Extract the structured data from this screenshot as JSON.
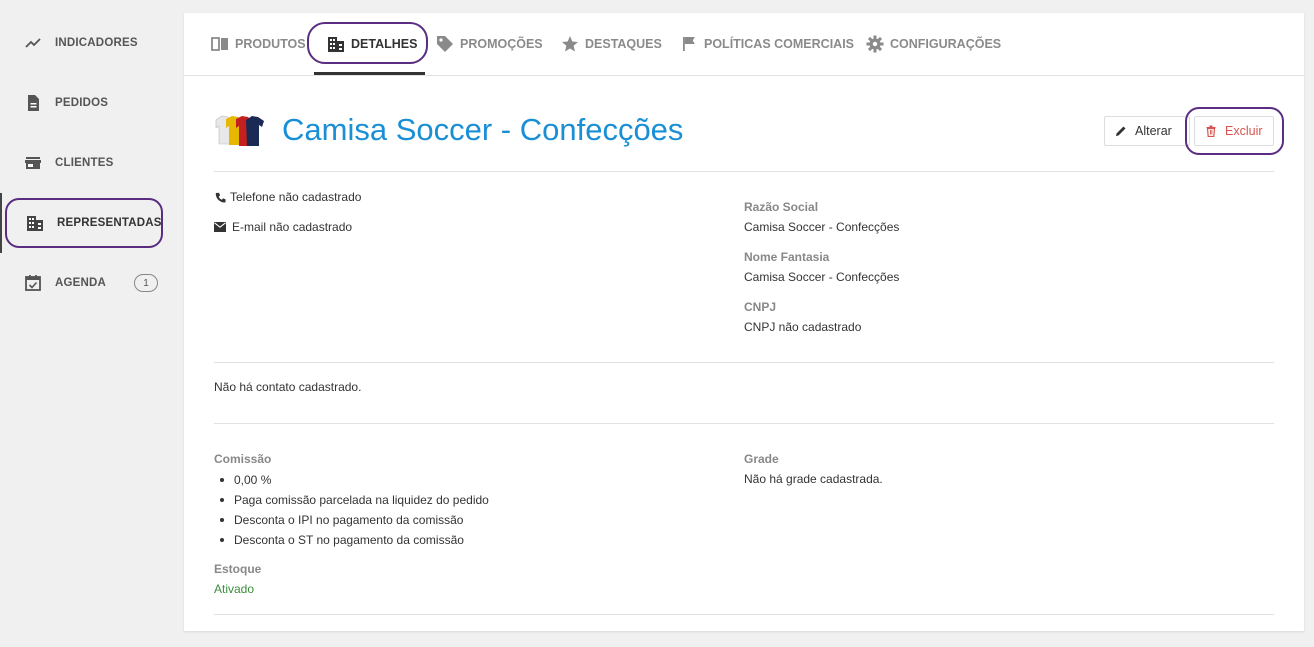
{
  "sidebar": {
    "items": [
      {
        "label": "INDICADORES",
        "icon": "trending-up-icon"
      },
      {
        "label": "PEDIDOS",
        "icon": "document-icon"
      },
      {
        "label": "CLIENTES",
        "icon": "store-icon"
      },
      {
        "label": "REPRESENTADAS",
        "icon": "building-icon",
        "active": true
      },
      {
        "label": "AGENDA",
        "icon": "calendar-check-icon",
        "badge": "1"
      }
    ]
  },
  "tabs": [
    {
      "label": "PRODUTOS",
      "icon": "book-icon"
    },
    {
      "label": "DETALHES",
      "icon": "building-icon",
      "active": true
    },
    {
      "label": "PROMOÇÕES",
      "icon": "tag-icon"
    },
    {
      "label": "DESTAQUES",
      "icon": "star-icon"
    },
    {
      "label": "POLÍTICAS COMERCIAIS",
      "icon": "flag-icon"
    },
    {
      "label": "CONFIGURAÇÕES",
      "icon": "gear-icon"
    }
  ],
  "company": {
    "title": "Camisa Soccer - Confecções",
    "phone": "Telefone não cadastrado",
    "email": "E-mail não cadastrado",
    "razao_social_label": "Razão Social",
    "razao_social": "Camisa Soccer - Confecções",
    "nome_fantasia_label": "Nome Fantasia",
    "nome_fantasia": "Camisa Soccer - Confecções",
    "cnpj_label": "CNPJ",
    "cnpj": "CNPJ não cadastrado"
  },
  "actions": {
    "alterar": "Alterar",
    "excluir": "Excluir"
  },
  "contato": "Não há contato cadastrado.",
  "comissao": {
    "label": "Comissão",
    "items": [
      "0,00 %",
      "Paga comissão parcelada na liquidez do pedido",
      "Desconta o IPI no pagamento da comissão",
      "Desconta o ST no pagamento da comissão"
    ]
  },
  "estoque": {
    "label": "Estoque",
    "value": "Ativado"
  },
  "grade": {
    "label": "Grade",
    "value": "Não há grade cadastrada."
  },
  "colors": {
    "title_blue": "#1a8fd6",
    "highlight_purple": "#5a2d82",
    "delete_red": "#d9534f",
    "active_green": "#3c8c3c"
  }
}
